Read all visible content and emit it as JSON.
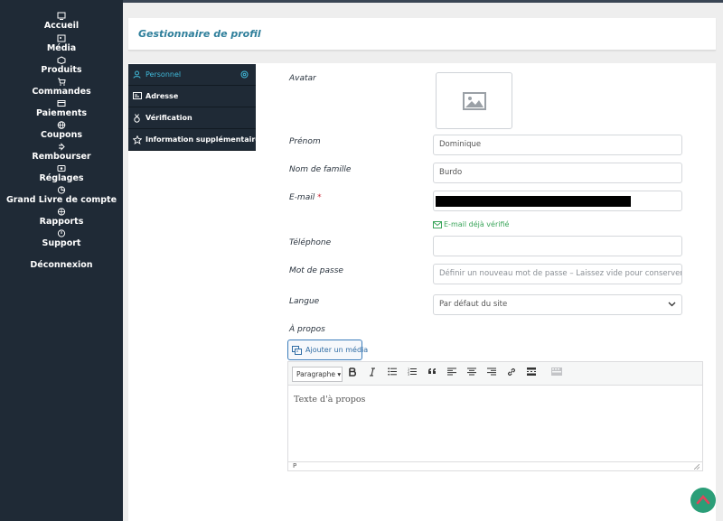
{
  "sidebar": {
    "items": [
      {
        "label": "Accueil",
        "icon": "home-icon"
      },
      {
        "label": "Média",
        "icon": "media-icon"
      },
      {
        "label": "Produits",
        "icon": "products-icon"
      },
      {
        "label": "Commandes",
        "icon": "cart-icon"
      },
      {
        "label": "Paiements",
        "icon": "credit-card-icon"
      },
      {
        "label": "Coupons",
        "icon": "globe-icon"
      },
      {
        "label": "Rembourser",
        "icon": "refund-icon"
      },
      {
        "label": "Réglages",
        "icon": "gear-icon"
      },
      {
        "label": "Grand Livre de compte",
        "icon": "ledger-icon"
      },
      {
        "label": "Rapports",
        "icon": "reports-icon"
      },
      {
        "label": "Support",
        "icon": "support-icon"
      },
      {
        "label": "Déconnexion",
        "icon": "power-icon"
      }
    ]
  },
  "header": {
    "title": "Gestionnaire de profil"
  },
  "tabs": [
    {
      "label": "Personnel",
      "active": true
    },
    {
      "label": "Adresse",
      "active": false
    },
    {
      "label": "Vérification",
      "active": false
    },
    {
      "label": "Information supplémentaire",
      "active": false
    }
  ],
  "form": {
    "avatar_label": "Avatar",
    "firstname_label": "Prénom",
    "firstname_value": "Dominique",
    "lastname_label": "Nom de famille",
    "lastname_value": "Burdo",
    "email_label": "E-mail",
    "email_required_mark": "*",
    "email_verified_text": "E-mail déjà vérifié",
    "phone_label": "Téléphone",
    "phone_value": "",
    "password_label": "Mot de passe",
    "password_placeholder": "Définir un nouveau mot de passe – Laissez vide pour conserver le",
    "language_label": "Langue",
    "language_value": "Par défaut du site",
    "about_label": "À propos"
  },
  "editor": {
    "add_media_label": "Ajouter un média",
    "format_label": "Paragraphe",
    "body_placeholder": "Texte d'à propos",
    "status_path": "P"
  },
  "colors": {
    "sidebar_bg": "#1f2a36",
    "active_tab": "#40b9d9",
    "verified": "#3aa55a",
    "required": "#cc2a3a",
    "scroll_top_bg": "#2b9e78",
    "scroll_top_arrow": "#e0455a"
  }
}
